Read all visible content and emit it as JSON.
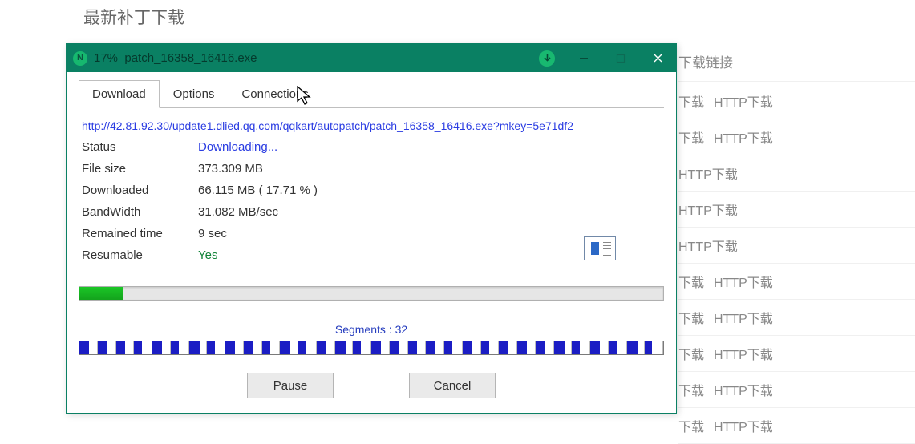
{
  "page": {
    "heading": "最新补丁下载"
  },
  "bgTable": {
    "header": "下载链接",
    "rows": [
      [
        "下载",
        "HTTP下载"
      ],
      [
        "下载",
        "HTTP下载"
      ],
      [
        "HTTP下载"
      ],
      [
        "HTTP下载"
      ],
      [
        "HTTP下载"
      ],
      [
        "下载",
        "HTTP下载"
      ],
      [
        "下载",
        "HTTP下载"
      ],
      [
        "下载",
        "HTTP下载"
      ],
      [
        "下载",
        "HTTP下载"
      ],
      [
        "下载",
        "HTTP下载"
      ]
    ]
  },
  "window": {
    "titlePercent": "17%",
    "titleFile": "patch_16358_16416.exe",
    "tabs": {
      "download": "Download",
      "options": "Options",
      "connections": "Connections"
    },
    "url": "http://42.81.92.30/update1.dlied.qq.com/qqkart/autopatch/patch_16358_16416.exe?mkey=5e71df2",
    "labels": {
      "status": "Status",
      "filesize": "File size",
      "downloaded": "Downloaded",
      "bandwidth": "BandWidth",
      "remained": "Remained time",
      "resumable": "Resumable"
    },
    "values": {
      "status": "Downloading...",
      "filesize": "373.309 MB",
      "downloaded": "66.115 MB ( 17.71 % )",
      "bandwidth": "31.082 MB/sec",
      "remained": "9 sec",
      "resumable": "Yes"
    },
    "segmentsLabel": "Segments : 32",
    "buttons": {
      "pause": "Pause",
      "cancel": "Cancel"
    }
  }
}
